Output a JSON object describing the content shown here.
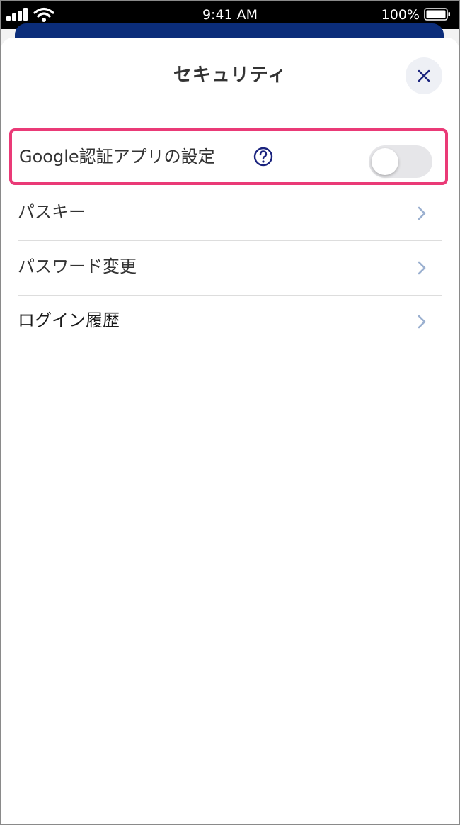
{
  "status_bar": {
    "time": "9:41 AM",
    "battery": "100%"
  },
  "sheet": {
    "title": "セキュリティ",
    "close_icon": "close-icon"
  },
  "google_auth": {
    "label": "Google認証アプリの設定",
    "help_icon": "help-circle-icon",
    "enabled": false
  },
  "menu": {
    "items": [
      {
        "label": "パスキー"
      },
      {
        "label": "パスワード変更"
      },
      {
        "label": "ログイン履歴"
      }
    ]
  },
  "colors": {
    "accent_navy": "#0b2d7a",
    "highlight": "#ea3a77",
    "help_icon": "#1a237e",
    "chevron": "#9bb0d0"
  }
}
